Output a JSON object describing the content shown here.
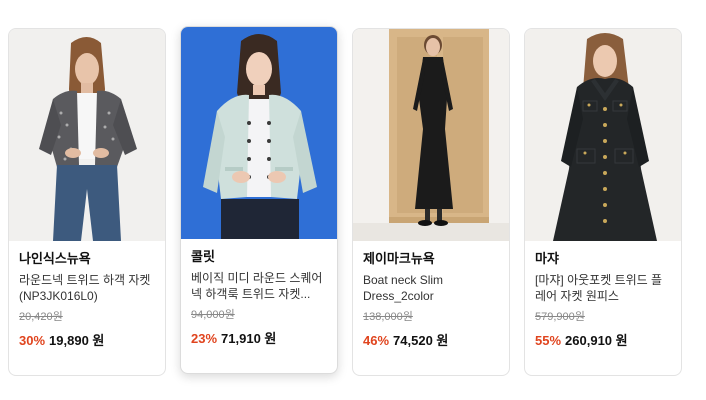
{
  "colors": {
    "discount": "#e0441e",
    "text": "#111111",
    "muted": "#888888",
    "border": "#e3e3e3"
  },
  "products": [
    {
      "brand": "나인식스뉴욕",
      "title": "라운드넥 트위드 하객 자켓 (NP3JK016L0)",
      "original_price": "20,420원",
      "discount": "30%",
      "price": "19,890",
      "currency": "원",
      "image": "model-tweed-cropped-jacket-jeans"
    },
    {
      "brand": "콜릿",
      "title": "베이직 미디 라운드 스퀘어 넥 하객룩 트위드 자켓...",
      "original_price": "94,000원",
      "discount": "23%",
      "price": "71,910",
      "currency": "원",
      "image": "model-mint-tweed-jacket-blue-background"
    },
    {
      "brand": "제이마크뉴욕",
      "title": "Boat neck Slim Dress_2color",
      "original_price": "138,000원",
      "discount": "46%",
      "price": "74,520",
      "currency": "원",
      "image": "model-black-long-dress-wood-door"
    },
    {
      "brand": "마쟈",
      "title": "[마쟈] 아웃포켓 트위드 플레어 자켓 원피스",
      "original_price": "579,900원",
      "discount": "55%",
      "price": "260,910",
      "currency": "원",
      "image": "model-black-tweed-jacket-dress"
    }
  ]
}
